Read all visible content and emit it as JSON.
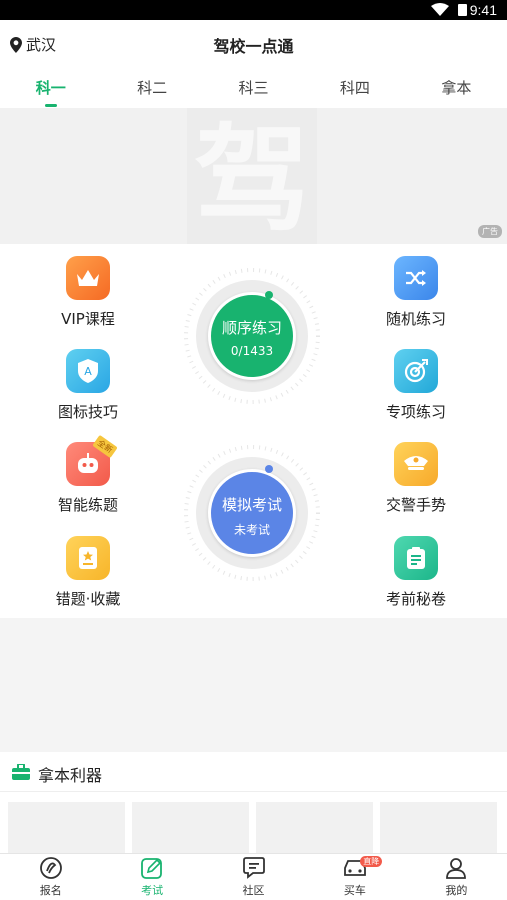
{
  "status": {
    "time": "9:41"
  },
  "header": {
    "location": "武汉",
    "title": "驾校一点通"
  },
  "tabs": [
    {
      "label": "科一",
      "active": true
    },
    {
      "label": "科二",
      "active": false
    },
    {
      "label": "科三",
      "active": false
    },
    {
      "label": "科四",
      "active": false
    },
    {
      "label": "拿本",
      "active": false
    }
  ],
  "banner": {
    "logo_char": "驾",
    "ad_tag": "广告"
  },
  "features": {
    "vip": "VIP课程",
    "icons": "图标技巧",
    "smart": "智能练题",
    "smart_badge": "全新",
    "wrong": "错题·收藏",
    "random": "随机练习",
    "special": "专项练习",
    "gesture": "交警手势",
    "secret": "考前秘卷"
  },
  "practice": {
    "title": "顺序练习",
    "progress": "0/1433",
    "color": "#18b36f"
  },
  "exam": {
    "title": "模拟考试",
    "status": "未考试",
    "color": "#5b85e6"
  },
  "section": {
    "title": "拿本利器"
  },
  "bottom_nav": [
    {
      "label": "报名",
      "icon": "register-icon",
      "active": false
    },
    {
      "label": "考试",
      "icon": "exam-icon",
      "active": true
    },
    {
      "label": "社区",
      "icon": "community-icon",
      "active": false
    },
    {
      "label": "买车",
      "icon": "car-icon",
      "active": false,
      "badge": "直降"
    },
    {
      "label": "我的",
      "icon": "profile-icon",
      "active": false
    }
  ],
  "colors": {
    "accent": "#18b36f",
    "exam_blue": "#5b85e6"
  }
}
